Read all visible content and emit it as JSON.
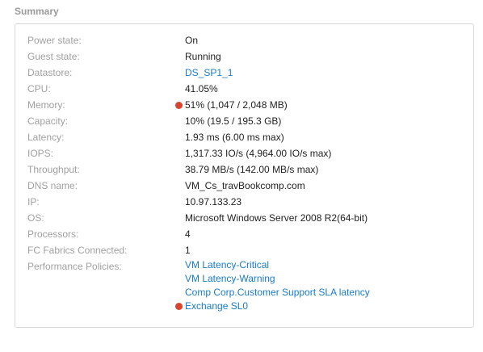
{
  "section": {
    "title": "Summary"
  },
  "rows": [
    {
      "label": "Power state:",
      "value": "On"
    },
    {
      "label": "Guest state:",
      "value": "Running"
    },
    {
      "label": "Datastore:",
      "value": "DS_SP1_1"
    },
    {
      "label": "CPU:",
      "value": "41.05%"
    },
    {
      "label": "Memory:",
      "value": "51% (1,047 / 2,048 MB)"
    },
    {
      "label": "Capacity:",
      "value": "10% (19.5 / 195.3 GB)"
    },
    {
      "label": "Latency:",
      "value": "1.93 ms (6.00 ms max)"
    },
    {
      "label": "IOPS:",
      "value": "1,317.33 IO/s (4,964.00 IO/s max)"
    },
    {
      "label": "Throughput:",
      "value": "38.79 MB/s (142.00 MB/s max)"
    },
    {
      "label": "DNS name:",
      "value": "VM_Cs_travBookcomp.com"
    },
    {
      "label": "IP:",
      "value": "10.97.133.23"
    },
    {
      "label": "OS:",
      "value": "Microsoft Windows Server 2008 R2(64-bit)"
    },
    {
      "label": "Processors:",
      "value": "4"
    },
    {
      "label": "FC Fabrics Connected:",
      "value": "1"
    },
    {
      "label": "Performance Policies:"
    }
  ],
  "policies": [
    {
      "label": "VM Latency-Critical"
    },
    {
      "label": "VM Latency-Warning"
    },
    {
      "label": "Comp Corp.Customer Support SLA latency"
    },
    {
      "label": "Exchange SL0"
    }
  ],
  "colors": {
    "alert_dot": "#d9432f",
    "link": "#1a7cc4",
    "label": "#a0a0a0"
  }
}
